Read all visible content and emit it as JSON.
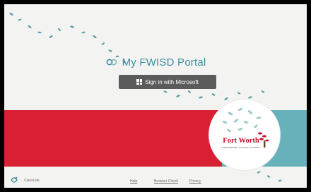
{
  "app": {
    "title": "My FWISD Portal",
    "logo_icon": "link-brand-icon"
  },
  "signin": {
    "label": "Sign in with Microsoft",
    "icon": "windows-logo-icon"
  },
  "seal": {
    "name": "Fort Worth",
    "subtitle": "INDEPENDENT SCHOOL DISTRICT",
    "icon": "tree-icon"
  },
  "footer": {
    "company": "ClassLink",
    "logo_icon": "classlink-logo-icon",
    "links": {
      "help": "Help",
      "browser_check": "Browser Check",
      "privacy": "Privacy"
    }
  },
  "colors": {
    "background": "#f3f3f1",
    "accent_teal": "#3f8ea0",
    "band_red": "#d81f33",
    "band_teal": "#67b1bb",
    "button": "#5b5b5b"
  }
}
